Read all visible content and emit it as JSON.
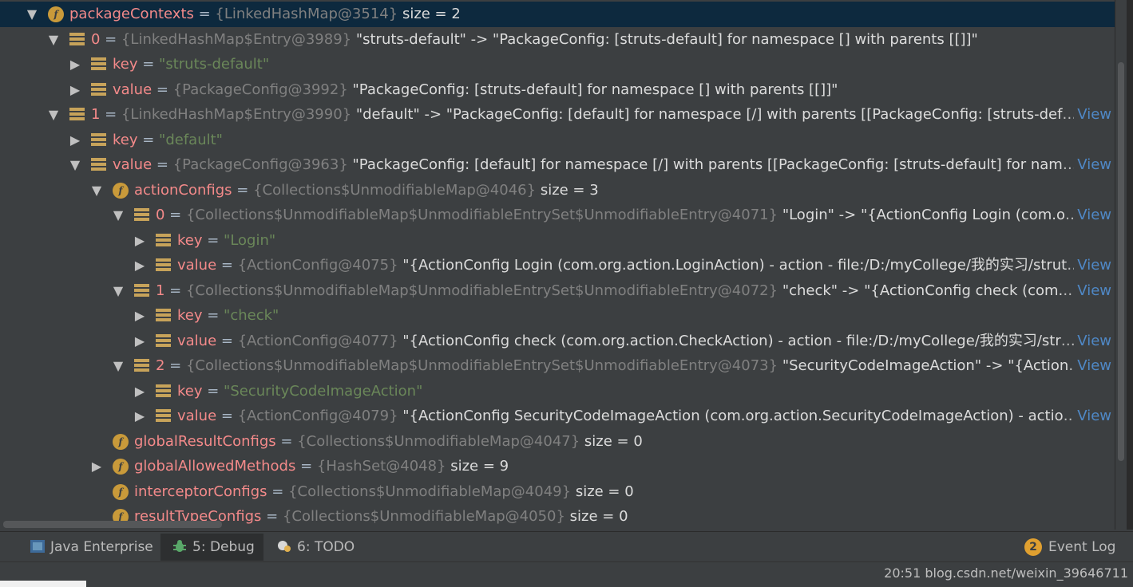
{
  "tree": {
    "rows": [
      {
        "expand": "expanded",
        "icon": "field",
        "name": "packageContexts",
        "ref": "{LinkedHashMap@3514}",
        "value": "size = 2",
        "view": ""
      },
      {
        "expand": "expanded",
        "icon": "entry",
        "name": "0",
        "ref": "{LinkedHashMap$Entry@3989}",
        "value": "\"struts-default\" -> \"PackageConfig: [struts-default] for namespace [] with parents [[]]\"",
        "view": ""
      },
      {
        "expand": "collapsed",
        "icon": "entry",
        "name": "key",
        "ref": "",
        "str": "\"struts-default\"",
        "value": "",
        "view": ""
      },
      {
        "expand": "collapsed",
        "icon": "entry",
        "name": "value",
        "ref": "{PackageConfig@3992}",
        "value": "\"PackageConfig: [struts-default] for namespace [] with parents [[]]\"",
        "view": ""
      },
      {
        "expand": "expanded",
        "icon": "entry",
        "name": "1",
        "ref": "{LinkedHashMap$Entry@3990}",
        "value": "\"default\" -> \"PackageConfig: [default] for namespace [/] with parents [[PackageConfig: [struts-default] for n",
        "view": "View"
      },
      {
        "expand": "collapsed",
        "icon": "entry",
        "name": "key",
        "ref": "",
        "str": "\"default\"",
        "value": "",
        "view": ""
      },
      {
        "expand": "expanded",
        "icon": "entry",
        "name": "value",
        "ref": "{PackageConfig@3963}",
        "value": "\"PackageConfig: [default] for namespace [/] with parents [[PackageConfig: [struts-default] for namespace [] ...",
        "view": "View"
      },
      {
        "expand": "expanded",
        "icon": "field",
        "name": "actionConfigs",
        "ref": "{Collections$UnmodifiableMap@4046}",
        "value": "size = 3",
        "view": ""
      },
      {
        "expand": "expanded",
        "icon": "entry",
        "name": "0",
        "ref": "{Collections$UnmodifiableMap$UnmodifiableEntrySet$UnmodifiableEntry@4071}",
        "value": "\"Login\" -> \"{ActionConfig Login (com.org.actio...",
        "view": "View"
      },
      {
        "expand": "collapsed",
        "icon": "entry",
        "name": "key",
        "ref": "",
        "str": "\"Login\"",
        "value": "",
        "view": ""
      },
      {
        "expand": "collapsed",
        "icon": "entry",
        "name": "value",
        "ref": "{ActionConfig@4075}",
        "value": "\"{ActionConfig Login (com.org.action.LoginAction) - action - file:/D:/myCollege/我的实习/struts_test/...",
        "view": "View"
      },
      {
        "expand": "expanded",
        "icon": "entry",
        "name": "1",
        "ref": "{Collections$UnmodifiableMap$UnmodifiableEntrySet$UnmodifiableEntry@4072}",
        "value": "\"check\" -> \"{ActionConfig check (com.org.actio...",
        "view": "View"
      },
      {
        "expand": "collapsed",
        "icon": "entry",
        "name": "key",
        "ref": "",
        "str": "\"check\"",
        "value": "",
        "view": ""
      },
      {
        "expand": "collapsed",
        "icon": "entry",
        "name": "value",
        "ref": "{ActionConfig@4077}",
        "value": "\"{ActionConfig check (com.org.action.CheckAction) - action - file:/D:/myCollege/我的实习/struts_test...",
        "view": "View"
      },
      {
        "expand": "expanded",
        "icon": "entry",
        "name": "2",
        "ref": "{Collections$UnmodifiableMap$UnmodifiableEntrySet$UnmodifiableEntry@4073}",
        "value": "\"SecurityCodeImageAction\" -> \"{ActionConfig...",
        "view": "View"
      },
      {
        "expand": "collapsed",
        "icon": "entry",
        "name": "key",
        "ref": "",
        "str": "\"SecurityCodeImageAction\"",
        "value": "",
        "view": ""
      },
      {
        "expand": "collapsed",
        "icon": "entry",
        "name": "value",
        "ref": "{ActionConfig@4079}",
        "value": "\"{ActionConfig SecurityCodeImageAction (com.org.action.SecurityCodeImageAction) - action - file:/l...",
        "view": "View"
      },
      {
        "expand": "none",
        "icon": "field",
        "name": "globalResultConfigs",
        "ref": "{Collections$UnmodifiableMap@4047}",
        "value": "size = 0",
        "view": ""
      },
      {
        "expand": "collapsed",
        "icon": "field",
        "name": "globalAllowedMethods",
        "ref": "{HashSet@4048}",
        "value": "size = 9",
        "view": ""
      },
      {
        "expand": "none",
        "icon": "field",
        "name": "interceptorConfigs",
        "ref": "{Collections$UnmodifiableMap@4049}",
        "value": "size = 0",
        "view": ""
      },
      {
        "expand": "none",
        "icon": "field",
        "name": "resultTypeConfigs",
        "ref": "{Collections$UnmodifiableMap@4050}",
        "value": "size = 0",
        "view": ""
      }
    ]
  },
  "bottom_tabs": [
    {
      "label": "Java Enterprise",
      "icon": "java-enterprise-icon"
    },
    {
      "label": "5: Debug",
      "icon": "debug-bug-icon"
    },
    {
      "label": "6: TODO",
      "icon": "todo-icon"
    }
  ],
  "event_log": {
    "badge": "2",
    "label": "Event Log"
  },
  "status": {
    "text": "20:51 blog.csdn.net/weixin_39646711"
  }
}
